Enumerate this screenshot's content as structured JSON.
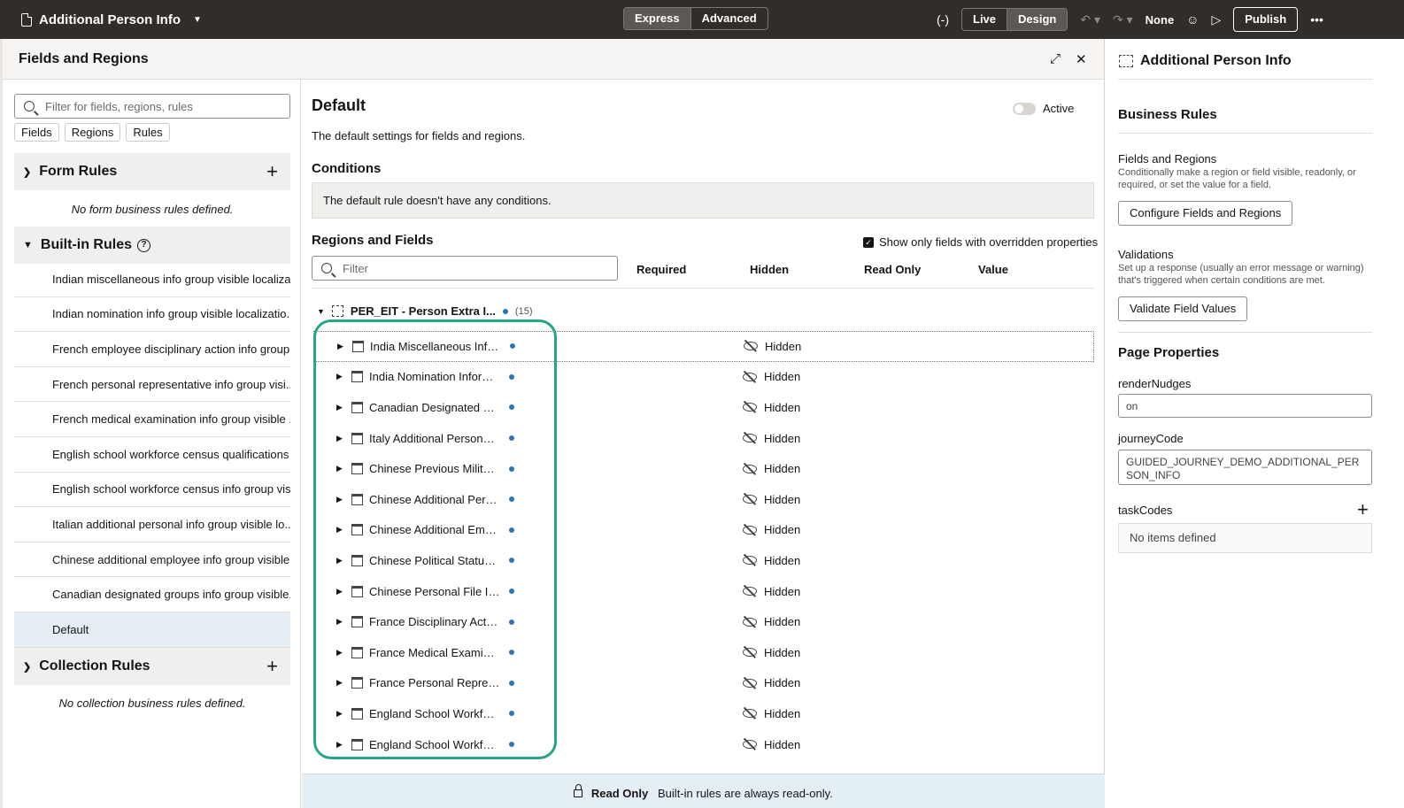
{
  "topbar": {
    "page_title": "Additional Person Info",
    "mode_tabs": [
      "Express",
      "Advanced"
    ],
    "view_tabs": [
      "Live",
      "Design"
    ],
    "variable_icon": "(-)",
    "none_label": "None",
    "publish_label": "Publish",
    "more_label": "•••"
  },
  "fields_panel": {
    "title": "Fields and Regions",
    "search_placeholder": "Filter for fields, regions, rules",
    "chips": [
      "Fields",
      "Regions",
      "Rules"
    ],
    "form_rules": {
      "title": "Form Rules",
      "empty": "No form business rules defined."
    },
    "builtin_rules": {
      "title": "Built-in Rules",
      "items": [
        "Indian miscellaneous info group visible localiza...",
        "Indian nomination info group visible localizatio...",
        "French employee disciplinary action info group...",
        "French personal representative info group visi...",
        "French medical examination info group visible ...",
        "English school workforce census qualifications ...",
        "English school workforce census info group vis...",
        "Italian additional personal info group visible lo...",
        "Chinese additional employee info group visible...",
        "Canadian designated groups info group visible...",
        "Default"
      ]
    },
    "collection_rules": {
      "title": "Collection Rules",
      "empty": "No collection business rules defined."
    }
  },
  "detail": {
    "title": "Default",
    "active_label": "Active",
    "description": "The default settings for fields and regions.",
    "conditions_title": "Conditions",
    "conditions_text": "The default rule doesn't have any conditions.",
    "regions_title": "Regions and Fields",
    "show_only_label": "Show only fields with overridden properties",
    "filter_placeholder": "Filter",
    "columns": [
      "Required",
      "Hidden",
      "Read Only",
      "Value"
    ],
    "group": {
      "name": "PER_EIT - Person Extra I...",
      "count": "(15)"
    },
    "rows": [
      {
        "name": "India Miscellaneous Infor...",
        "hidden": "Hidden"
      },
      {
        "name": "India Nomination Inform...",
        "hidden": "Hidden"
      },
      {
        "name": "Canadian Designated Gr...",
        "hidden": "Hidden"
      },
      {
        "name": "Italy Additional Personal I...",
        "hidden": "Hidden"
      },
      {
        "name": "Chinese Previous Military...",
        "hidden": "Hidden"
      },
      {
        "name": "Chinese Additional Perso...",
        "hidden": "Hidden"
      },
      {
        "name": "Chinese Additional Empl...",
        "hidden": "Hidden"
      },
      {
        "name": "Chinese Political Status I...",
        "hidden": "Hidden"
      },
      {
        "name": "Chinese Personal File Inf...",
        "hidden": "Hidden"
      },
      {
        "name": "France Disciplinary Actio...",
        "hidden": "Hidden"
      },
      {
        "name": "France Medical Examinat...",
        "hidden": "Hidden"
      },
      {
        "name": "France Personal Represe...",
        "hidden": "Hidden"
      },
      {
        "name": "England School Workforc...",
        "hidden": "Hidden"
      },
      {
        "name": "England School Workforc...",
        "hidden": "Hidden"
      }
    ],
    "readonly_label": "Read Only",
    "readonly_text": "Built-in rules are always read-only."
  },
  "properties": {
    "title": "Additional Person Info",
    "business_rules": "Business Rules",
    "fr_title": "Fields and Regions",
    "fr_desc": "Conditionally make a region or field visible, readonly, or required, or set the value for a field.",
    "fr_button": "Configure Fields and Regions",
    "val_title": "Validations",
    "val_desc": "Set up a response (usually an error message or warning) that's triggered when certain conditions are met.",
    "val_button": "Validate Field Values",
    "page_props": "Page Properties",
    "render_label": "renderNudges",
    "render_value": "on",
    "journey_label": "journeyCode",
    "journey_value": "GUIDED_JOURNEY_DEMO_ADDITIONAL_PERSON_INFO",
    "task_label": "taskCodes",
    "task_empty": "No items defined"
  },
  "colors": {
    "topbar": "#312d2a",
    "highlight": "#26a58a",
    "dot": "#2b77b7",
    "selected": "#e4eef4"
  }
}
